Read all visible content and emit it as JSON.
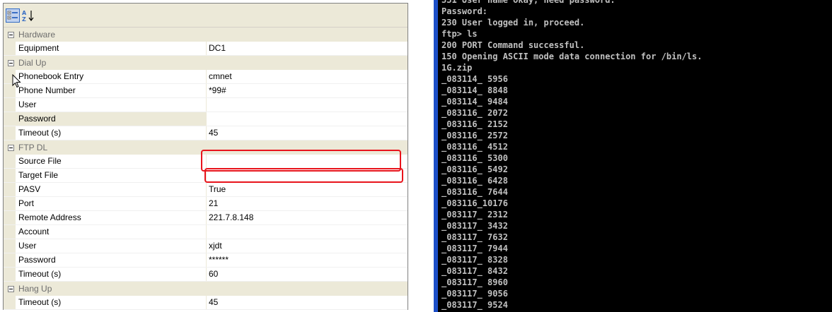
{
  "property_grid": {
    "toolbar": {
      "categorized_icon": "categorized-view-icon",
      "alphabetical_icon": "sort-alpha-icon"
    },
    "rows": [
      {
        "kind": "category",
        "label": "Hardware"
      },
      {
        "kind": "property",
        "name": "Equipment",
        "value": "DC1"
      },
      {
        "kind": "category",
        "label": "Dial Up"
      },
      {
        "kind": "property",
        "name": "Phonebook Entry",
        "value": "cmnet"
      },
      {
        "kind": "property",
        "name": "Phone Number",
        "value": "*99#"
      },
      {
        "kind": "property",
        "name": "User",
        "value": ""
      },
      {
        "kind": "property",
        "name": "Password",
        "value": "",
        "selected": true
      },
      {
        "kind": "property",
        "name": "Timeout (s)",
        "value": "45"
      },
      {
        "kind": "category",
        "label": "FTP DL"
      },
      {
        "kind": "property",
        "name": "Source File",
        "value": ""
      },
      {
        "kind": "property",
        "name": "Target File",
        "value": ""
      },
      {
        "kind": "property",
        "name": "PASV",
        "value": "True"
      },
      {
        "kind": "property",
        "name": "Port",
        "value": "21"
      },
      {
        "kind": "property",
        "name": "Remote Address",
        "value": "221.7.8.148"
      },
      {
        "kind": "property",
        "name": "Account",
        "value": ""
      },
      {
        "kind": "property",
        "name": "User",
        "value": "xjdt"
      },
      {
        "kind": "property",
        "name": "Password",
        "value": "******"
      },
      {
        "kind": "property",
        "name": "Timeout (s)",
        "value": "60"
      },
      {
        "kind": "category",
        "label": "Hang Up"
      },
      {
        "kind": "property",
        "name": "Timeout (s)",
        "value": "45"
      }
    ],
    "highlight_color": "#e8131b"
  },
  "console": {
    "lines": [
      "331 User name okay, need password.",
      "Password:",
      "230 User logged in, proceed.",
      "ftp> ls",
      "200 PORT Command successful.",
      "150 Opening ASCII mode data connection for /bin/ls.",
      "1G.zip",
      "_083114_ 5956",
      "_083114_ 8848",
      "_083114_ 9484",
      "_083116_ 2072",
      "_083116_ 2152",
      "_083116_ 2572",
      "_083116_ 4512",
      "_083116_ 5300",
      "_083116_ 5492",
      "_083116_ 6428",
      "_083116_ 7644",
      "_083116_10176",
      "_083117_ 2312",
      "_083117_ 3432",
      "_083117_ 7632",
      "_083117_ 7944",
      "_083117_ 8328",
      "_083117_ 8432",
      "_083117_ 8960",
      "_083117_ 9056",
      "_083117_ 9524"
    ],
    "background": "#000000",
    "text_color": "#c0c0c0"
  }
}
